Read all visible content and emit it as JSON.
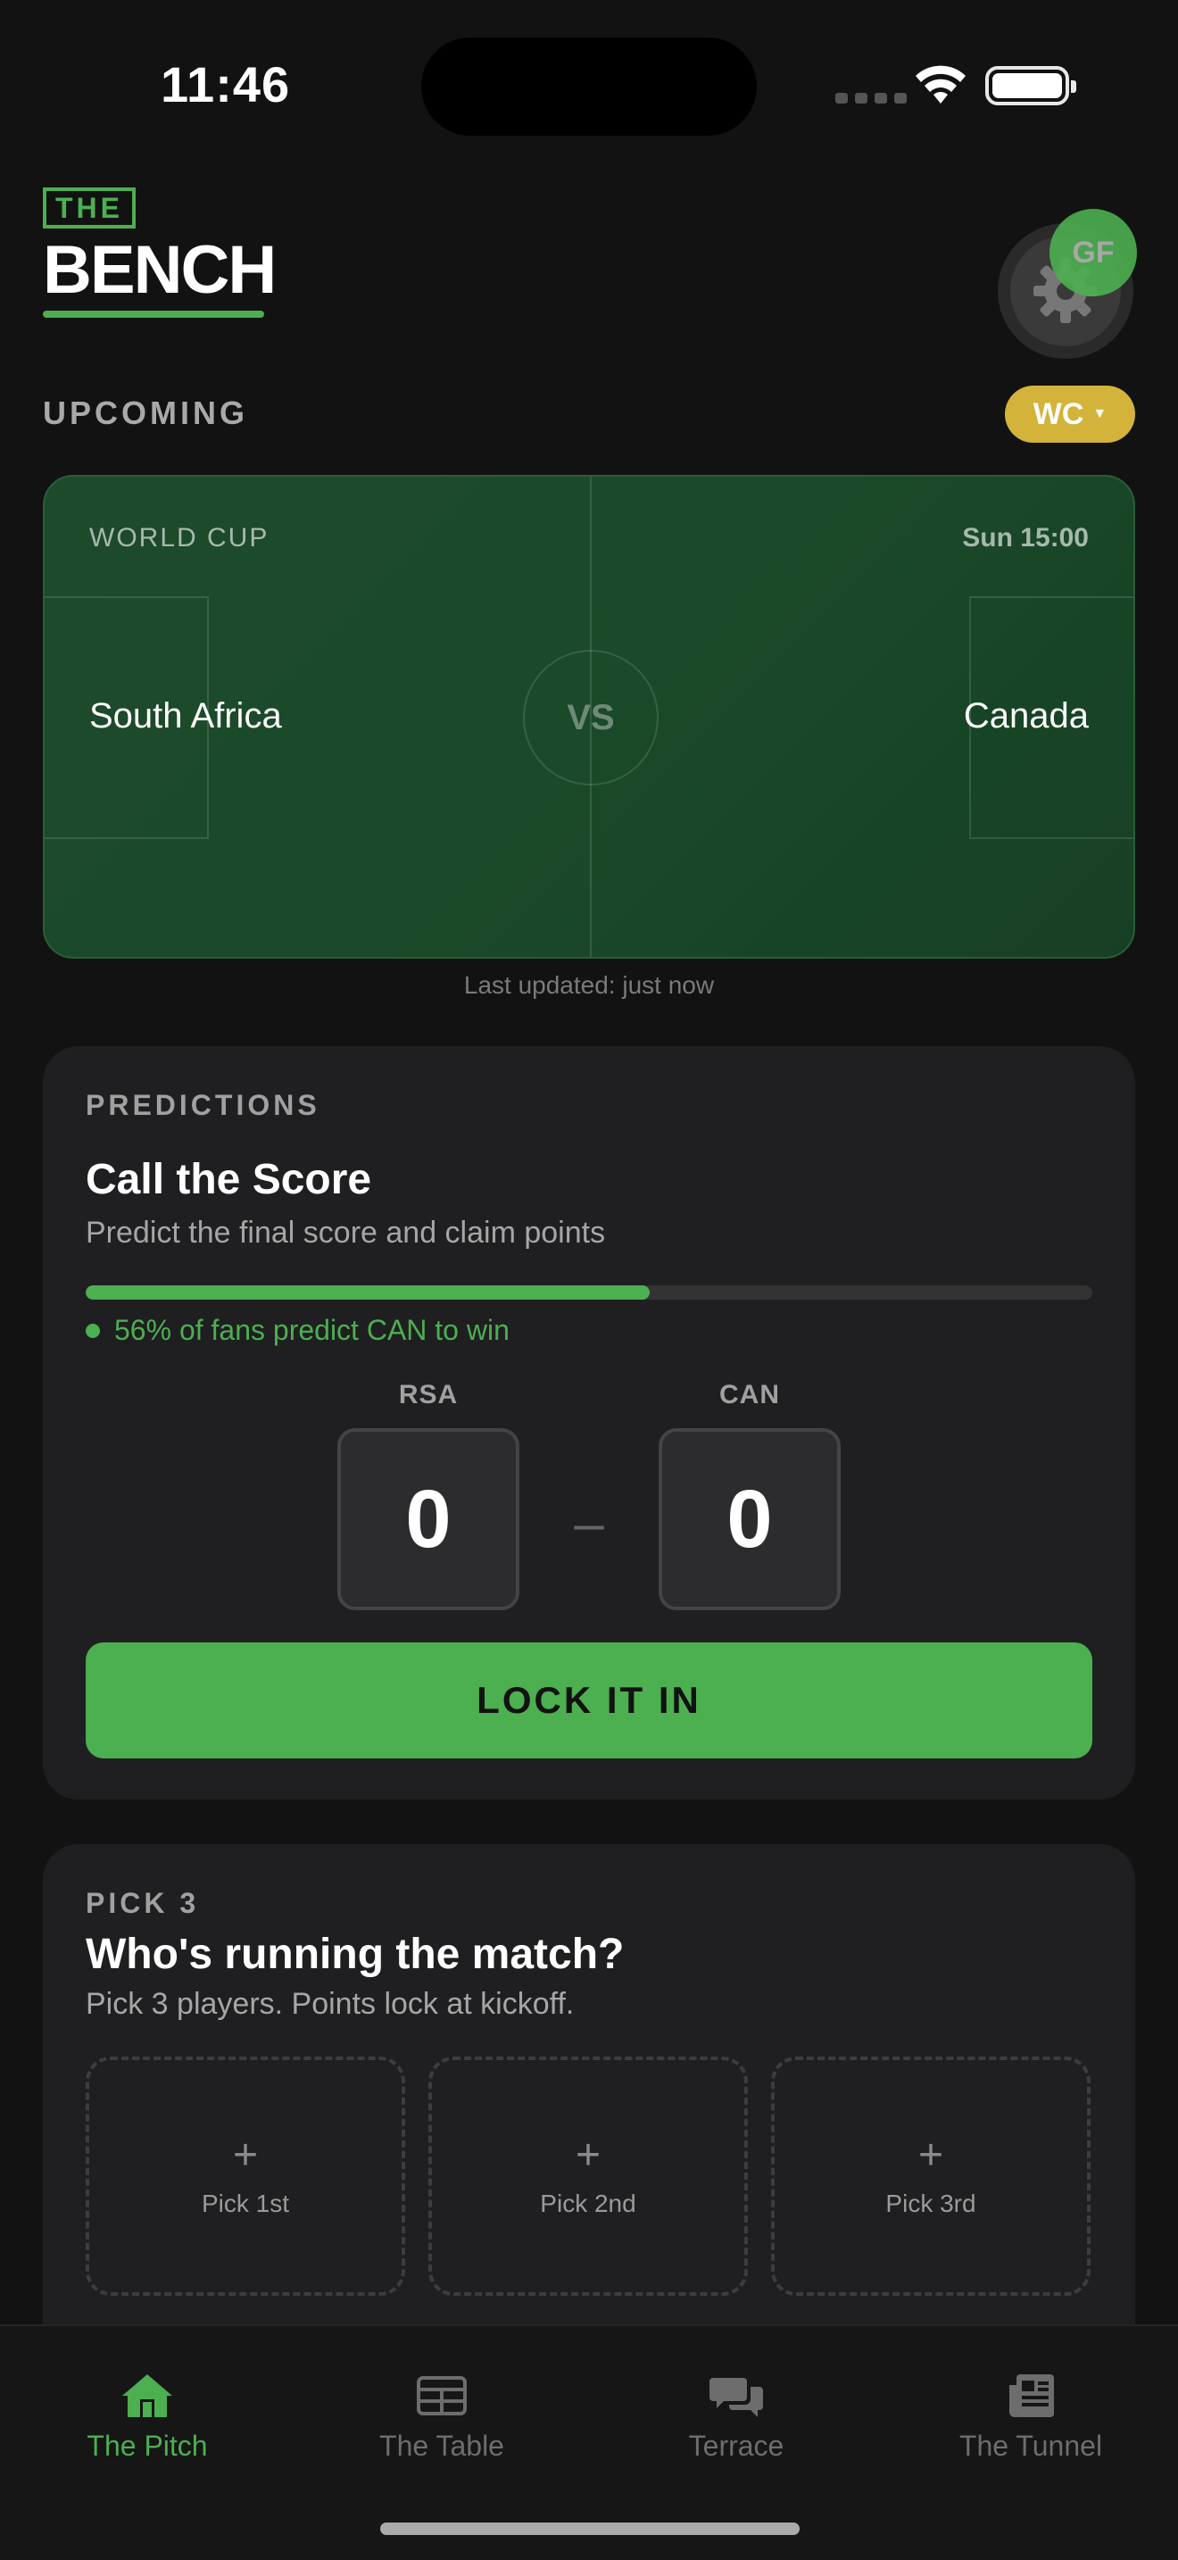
{
  "status": {
    "time": "11:46"
  },
  "header": {
    "logo_top": "THE",
    "logo_main": "BENCH",
    "avatar_initials": "GF"
  },
  "upcoming": {
    "section_label": "UPCOMING",
    "filter_label": "WC",
    "match": {
      "competition": "WORLD CUP",
      "kickoff": "Sun 15:00",
      "home": "South Africa",
      "away": "Canada",
      "vs": "VS"
    },
    "last_updated": "Last updated: just now"
  },
  "predictions": {
    "kicker": "PREDICTIONS",
    "title": "Call the Score",
    "subtitle": "Predict the final score and claim points",
    "fan_percent": 56,
    "fan_stat": "56% of fans predict CAN to win",
    "home_code": "RSA",
    "away_code": "CAN",
    "home_score": "0",
    "away_score": "0",
    "dash": "–",
    "lock_label": "LOCK IT IN"
  },
  "pick3": {
    "kicker": "PICK 3",
    "title": "Who's running the match?",
    "subtitle": "Pick 3 players. Points lock at kickoff.",
    "slots": [
      {
        "plus": "+",
        "label": "Pick 1st"
      },
      {
        "plus": "+",
        "label": "Pick 2nd"
      },
      {
        "plus": "+",
        "label": "Pick 3rd"
      }
    ]
  },
  "nav": {
    "items": [
      {
        "label": "The Pitch",
        "icon": "home-icon",
        "active": true
      },
      {
        "label": "The Table",
        "icon": "table-icon",
        "active": false
      },
      {
        "label": "Terrace",
        "icon": "chat-icon",
        "active": false
      },
      {
        "label": "The Tunnel",
        "icon": "newspaper-icon",
        "active": false
      }
    ]
  },
  "colors": {
    "accent": "#4caf50",
    "background": "#121212",
    "card": "#1f1f21",
    "pill": "#d4b33a",
    "pitch": "#1d4a2b"
  }
}
